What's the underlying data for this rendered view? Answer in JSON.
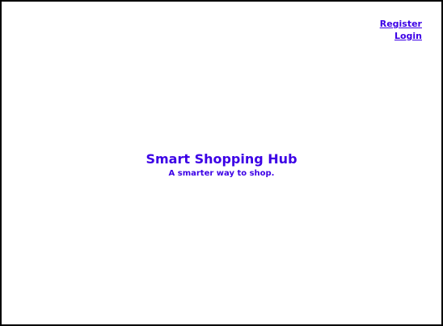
{
  "nav": {
    "register_label": "Register",
    "login_label": "Login"
  },
  "hero": {
    "title": "Smart Shopping Hub",
    "tagline": "A smarter way to shop."
  },
  "colors": {
    "accent": "#3c00e6",
    "background": "#ffffff",
    "border": "#000000"
  }
}
